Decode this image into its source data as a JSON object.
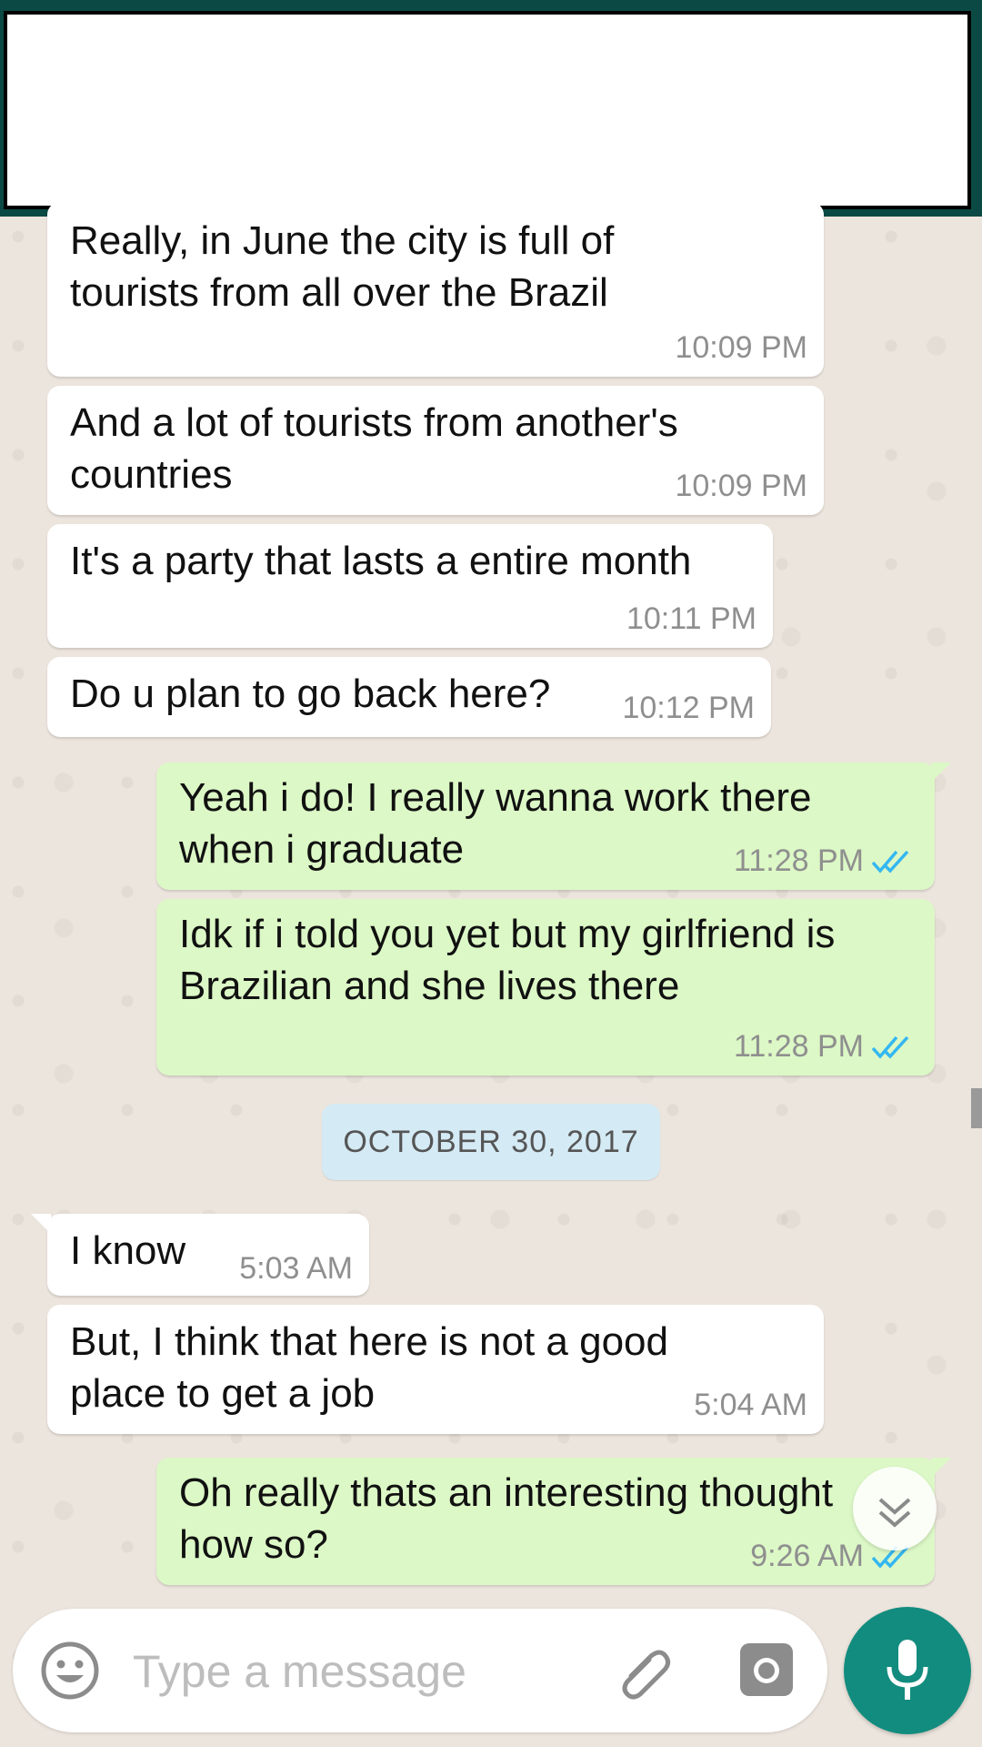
{
  "messages": [
    {
      "direction": "in",
      "text": "Really, in June the city is full of\ntourists from all over the Brazil",
      "time": "10:09 PM"
    },
    {
      "direction": "in",
      "text": "And a lot of tourists from another's\ncountries",
      "time": "10:09 PM"
    },
    {
      "direction": "in",
      "text": "It's a party that lasts a entire month",
      "time": "10:11 PM"
    },
    {
      "direction": "in",
      "text": "Do u plan to go back here?",
      "time": "10:12 PM"
    },
    {
      "direction": "out",
      "text": "Yeah i do! I really wanna work there\nwhen i graduate",
      "time": "11:28 PM",
      "status": "read"
    },
    {
      "direction": "out",
      "text": "Idk if i told you yet but my girlfriend is\nBrazilian and she lives there",
      "time": "11:28 PM",
      "status": "read"
    },
    {
      "direction": "in",
      "text": "I know",
      "time": "5:03 AM"
    },
    {
      "direction": "in",
      "text": "But, I think that here is not a good\nplace to get a job",
      "time": "5:04 AM"
    },
    {
      "direction": "out",
      "text": "Oh really thats an interesting thought\nhow so?",
      "time": "9:26 AM",
      "status": "read"
    }
  ],
  "date_separator": "OCTOBER 30, 2017",
  "composer": {
    "placeholder": "Type a message",
    "emoji_icon": "emoji-icon",
    "attach_icon": "paperclip-icon",
    "camera_icon": "camera-icon",
    "send_icon": "microphone-icon"
  },
  "colors": {
    "incoming_bubble": "#ffffff",
    "outgoing_bubble": "#dcf8c6",
    "read_ticks": "#34b7f1",
    "accent": "#128c7e",
    "header": "#0b4a44",
    "date_chip": "#d4eaf4"
  }
}
